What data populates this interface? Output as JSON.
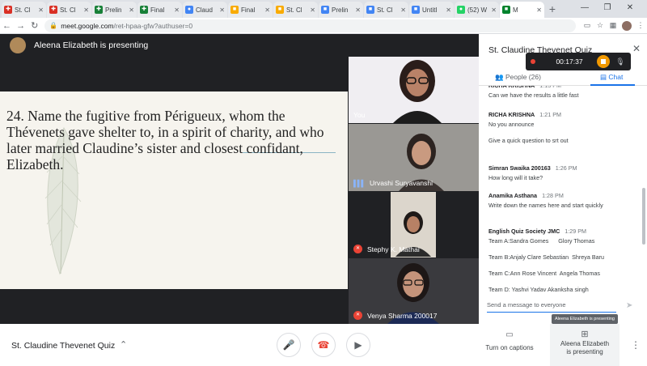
{
  "browser": {
    "tabs": [
      {
        "label": "St. Cl",
        "color": "#d93025",
        "glyph": "✚",
        "active": false
      },
      {
        "label": "St. Cl",
        "color": "#d93025",
        "glyph": "✚",
        "active": false
      },
      {
        "label": "Prelin",
        "color": "#188038",
        "glyph": "✚",
        "active": false
      },
      {
        "label": "Final",
        "color": "#188038",
        "glyph": "✚",
        "active": false
      },
      {
        "label": "Claud",
        "color": "#4285f4",
        "glyph": "●",
        "active": false
      },
      {
        "label": "Final",
        "color": "#f9ab00",
        "glyph": "■",
        "active": false
      },
      {
        "label": "St. Cl",
        "color": "#f9ab00",
        "glyph": "■",
        "active": false
      },
      {
        "label": "Prelin",
        "color": "#4285f4",
        "glyph": "■",
        "active": false
      },
      {
        "label": "St. Cl",
        "color": "#4285f4",
        "glyph": "■",
        "active": false
      },
      {
        "label": "Untitl",
        "color": "#4285f4",
        "glyph": "■",
        "active": false
      },
      {
        "label": "(52) W",
        "color": "#25d366",
        "glyph": "●",
        "active": false
      },
      {
        "label": "M",
        "color": "#00832d",
        "glyph": "■",
        "active": true
      }
    ],
    "url_host": "meet.google.com",
    "url_path": "/ret-hpaa-gfw?authuser=0"
  },
  "meet": {
    "presenter_label": "Aleena Elizabeth is presenting",
    "slide_question": "24. Name the fugitive from Périgueux, whom the Thévenets gave shelter to, in a spirit of charity, and who later married Claudine’s sister and closest confidant, Elizabeth.",
    "tiles": [
      {
        "name": "You",
        "muted": false,
        "speaking": false
      },
      {
        "name": "Urvashi Suryavanshi",
        "muted": false,
        "speaking": true
      },
      {
        "name": "Stephy K. Mathai",
        "muted": true,
        "speaking": false
      },
      {
        "name": "Venya Sharma 200017",
        "muted": true,
        "speaking": false
      }
    ]
  },
  "panel": {
    "title": "St. Claudine Thevenet Quiz",
    "recording_time": "00:17:37",
    "people_label": "People (26)",
    "chat_label": "Chat",
    "messages": [
      {
        "sender": "RICHA KRISHNA",
        "time": "1:13 PM",
        "lines": [
          "Can we have the results a little fast"
        ]
      },
      {
        "sender": "RICHA KRISHNA",
        "time": "1:21 PM",
        "lines": [
          "No you announce",
          "",
          "Give a quick question to srt out"
        ]
      },
      {
        "sender": "Simran Swaika 200163",
        "time": "1:26 PM",
        "lines": [
          "How long will it take?"
        ]
      },
      {
        "sender": "Anamika Asthana",
        "time": "1:28 PM",
        "lines": [
          "Write down the names here and start quickly"
        ]
      },
      {
        "sender": "English Quiz Society JMC",
        "time": "1:29 PM",
        "lines": [
          "Team A:Sandra Gomes      Glory Thomas",
          "",
          "Team B:Anjaly Clare Sebastian  Shreya Baru",
          "",
          "Team C:Ann Rose Vincent  Angela Thomas",
          "",
          "Team D: Yashvi Yadav Akanksha singh"
        ]
      }
    ],
    "input_placeholder": "Send a message to everyone"
  },
  "bottom": {
    "meeting_name": "St. Claudine Thevenet Quiz",
    "captions_label": "Turn on captions",
    "present_label_1": "Aleena Elizabeth",
    "present_label_2": "is presenting",
    "tooltip": "Aleena Elizabeth is presenting"
  },
  "colors": {
    "accent": "#1a73e8",
    "danger": "#ea4335",
    "record": "#f29900"
  }
}
